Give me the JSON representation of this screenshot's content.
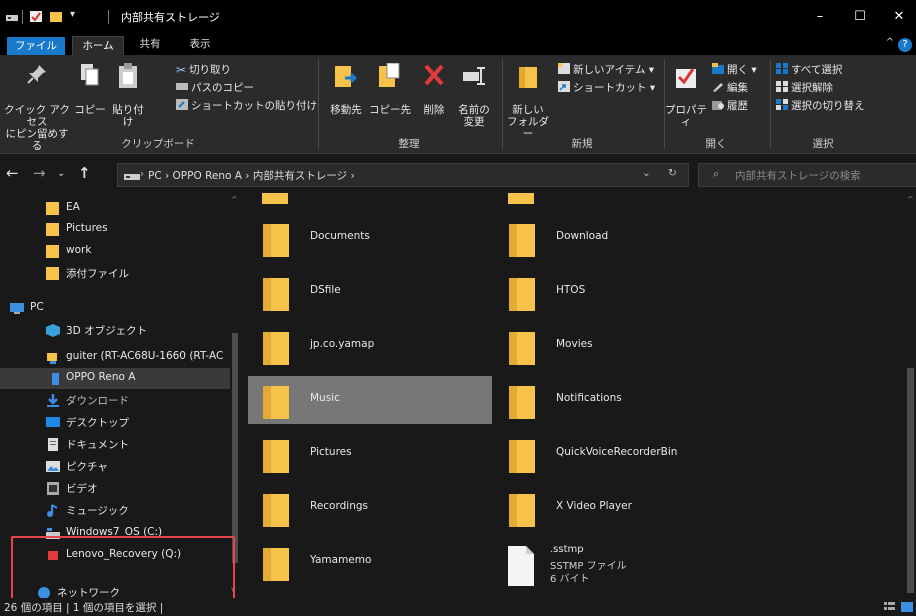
{
  "window": {
    "title": "内部共有ストレージ",
    "controls": [
      "–",
      "☐",
      "✕"
    ]
  },
  "ribbon_tabs": [
    "ファイル",
    "ホーム",
    "共有",
    "表示"
  ],
  "ribbon": {
    "clipboard": {
      "pin_label_1": "クイック アクセス",
      "pin_label_2": "にピン留めする",
      "copy": "コピー",
      "paste": "貼り付け",
      "cut": "切り取り",
      "copy_path": "パスのコピー",
      "paste_shortcut": "ショートカットの貼り付け",
      "group": "クリップボード"
    },
    "organize": {
      "move_to": "移動先",
      "copy_to": "コピー先",
      "delete": "削除",
      "rename_1": "名前の",
      "rename_2": "変更",
      "group": "整理"
    },
    "new": {
      "new_folder_1": "新しい",
      "new_folder_2": "フォルダー",
      "new_item": "新しいアイテム ▾",
      "shortcut": "ショートカット ▾",
      "group": "新規"
    },
    "open": {
      "properties": "プロパティ",
      "open": "開く ▾",
      "edit": "編集",
      "history": "履歴",
      "group": "開く"
    },
    "select": {
      "select_all": "すべて選択",
      "select_none": "選択解除",
      "invert": "選択の切り替え",
      "group": "選択"
    }
  },
  "address": {
    "path": "PC  ›  OPPO Reno A  ›  内部共有ストレージ  ›",
    "search_placeholder": "内部共有ストレージの検索"
  },
  "nav_items": [
    {
      "label": "EA",
      "icon": "folder-icon"
    },
    {
      "label": "Pictures",
      "icon": "folder-icon"
    },
    {
      "label": "work",
      "icon": "folder-icon"
    },
    {
      "label": "添付ファイル",
      "icon": "folder-icon"
    },
    {
      "label": "PC",
      "icon": "pc-icon"
    },
    {
      "label": "3D オブジェクト",
      "icon": "cube-icon"
    },
    {
      "label": "guiter (RT-AC68U-1660 (RT-AC",
      "icon": "network-drive-icon"
    },
    {
      "label": "OPPO Reno A",
      "icon": "phone-icon"
    },
    {
      "label": "ダウンロード",
      "icon": "download-icon"
    },
    {
      "label": "デスクトップ",
      "icon": "desktop-icon"
    },
    {
      "label": "ドキュメント",
      "icon": "document-icon"
    },
    {
      "label": "ピクチャ",
      "icon": "picture-icon"
    },
    {
      "label": "ビデオ",
      "icon": "video-icon"
    },
    {
      "label": "ミュージック",
      "icon": "music-icon"
    },
    {
      "label": "Windows7_OS (C:)",
      "icon": "drive-icon"
    },
    {
      "label": "Lenovo_Recovery (Q:)",
      "icon": "recovery-drive-icon"
    },
    {
      "label": "ネットワーク",
      "icon": "network-icon"
    }
  ],
  "files_left": [
    "Documents",
    "DSfile",
    "jp.co.yamap",
    "Music",
    "Pictures",
    "Recordings",
    "Yamamemo"
  ],
  "files_right": [
    "Download",
    "HTOS",
    "Movies",
    "Notifications",
    "QuickVoiceRecorderBin",
    "X Video Player"
  ],
  "sstmp": {
    "name": ".sstmp",
    "type": "SSTMP ファイル",
    "size": "6 バイト"
  },
  "status": {
    "text": "26 個の項目   |   1 個の項目を選択   |"
  },
  "colors": {
    "folder": "#f6c24a",
    "selection": "#777777",
    "highlight": "#e9454c",
    "accent": "#1979ca"
  }
}
